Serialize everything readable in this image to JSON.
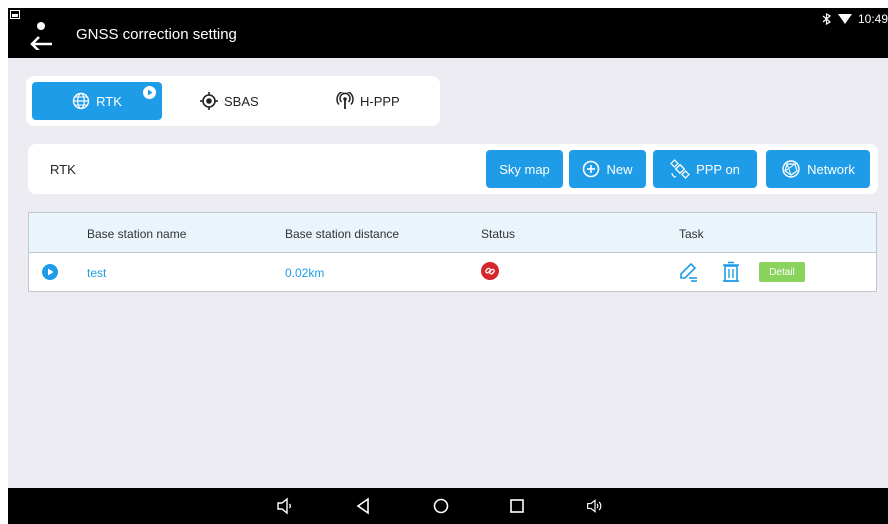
{
  "app": {
    "title": "GNSS correction setting"
  },
  "status_bar": {
    "time": "10:49"
  },
  "tabs": [
    {
      "label": "RTK",
      "active": true,
      "icon": "globe-icon"
    },
    {
      "label": "SBAS",
      "active": false,
      "icon": "target-icon"
    },
    {
      "label": "H-PPP",
      "active": false,
      "icon": "antenna-icon"
    }
  ],
  "toolbar": {
    "label": "RTK",
    "buttons": [
      {
        "label": "Sky map",
        "icon": ""
      },
      {
        "label": "New",
        "icon": "plus-circle-icon"
      },
      {
        "label": "PPP on",
        "icon": "satellite-icon"
      },
      {
        "label": "Network",
        "icon": "network-icon"
      }
    ]
  },
  "table": {
    "headers": [
      "Base station name",
      "Base station distance",
      "Status",
      "Task"
    ],
    "rows": [
      {
        "name": "test",
        "distance": "0.02km",
        "status": "disconnected-link-icon",
        "detail_label": "Detail"
      }
    ]
  },
  "colors": {
    "accent": "#1e9ce8",
    "detail": "#8ad35c",
    "status_error": "#d6262b",
    "background": "#ececf2"
  }
}
